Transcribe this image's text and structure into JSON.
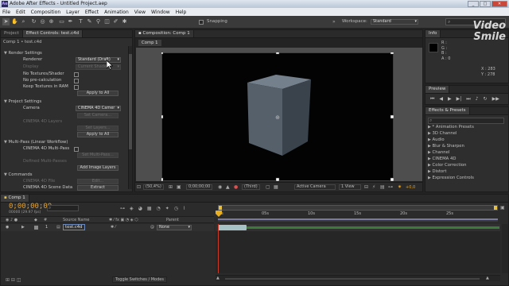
{
  "app": {
    "title": "Adobe After Effects - Untitled Project.aep",
    "logo_text": "Ae",
    "window_controls": [
      "_",
      "□",
      "✕"
    ]
  },
  "menu": [
    "File",
    "Edit",
    "Composition",
    "Layer",
    "Effect",
    "Animation",
    "View",
    "Window",
    "Help"
  ],
  "toolbar": {
    "snapping_label": "Snapping",
    "workspace_label": "Workspace:",
    "workspace_value": "Standard",
    "search_placeholder": "Search Help"
  },
  "left_panel": {
    "tabs": [
      "Project",
      "Effect Controls: test.c4d"
    ],
    "breadcrumb": "Comp 1 • test.c4d",
    "rows": {
      "render_settings": "Render Settings",
      "renderer_label": "Renderer",
      "renderer_value": "Standard (Draft)",
      "display_label": "Display",
      "display_value": "Current Shaded",
      "no_textures": "No Textures/Shader",
      "no_precalc": "No pre-calculation",
      "keep_textures": "Keep Textures in RAM",
      "apply_to_all_1": "Apply to All",
      "project_settings": "Project Settings",
      "camera_label": "Camera",
      "camera_value": "CINEMA 4D Camer",
      "set_camera": "Set Camera...",
      "layers_label": "CINEMA 4D Layers",
      "set_layers": "Set Layers...",
      "apply_to_all_2": "Apply to All",
      "multipass": "Multi-Pass (Linear Workflow)",
      "c4d_multipass": "CINEMA 4D Multi-Pass",
      "set_multipass": "Set Multi-Pass...",
      "defined_multipasses": "Defined Multi-Passes",
      "add_image_layers": "Add Image Layers",
      "commands": "Commands",
      "c4d_file": "CINEMA 4D File",
      "edit_btn": "Edit...",
      "c4d_scene_data": "CINEMA 4D Scene Data",
      "extract_btn": "Extract"
    }
  },
  "composition": {
    "tab": "Composition: Comp 1",
    "sub_tab": "Comp 1",
    "footer": {
      "zoom": "(50,4%)",
      "timecode": "0;00;00;00",
      "resolution": "(Third)",
      "camera": "Active Camera",
      "views": "1 View",
      "offset": "+0,0"
    }
  },
  "right_panels": {
    "info_tab": "Info",
    "info_values": [
      "R :",
      "G :",
      "B :",
      "A : 0",
      "X : 283",
      "Y : 278"
    ],
    "preview_tab": "Preview",
    "effects_tab": "Effects & Presets",
    "effects_search_placeholder": "",
    "effects_items": [
      "* Animation Presets",
      "3D Channel",
      "Audio",
      "Blur & Sharpen",
      "Channel",
      "CINEMA 4D",
      "Color Correction",
      "Distort",
      "Expression Controls"
    ]
  },
  "watermark": {
    "line1": "Video",
    "line2": "Smile"
  },
  "timeline": {
    "tab": "Comp 1",
    "timecode": "0;00;00;00",
    "fps": "00000 (29.97 fps)",
    "search_placeholder": "",
    "headers": {
      "num": "#",
      "source_name": "Source Name",
      "parent": "Parent"
    },
    "layer": {
      "index": "1",
      "name": "test.c4d",
      "parent": "None"
    },
    "ruler": [
      "0s",
      "05s",
      "10s",
      "15s",
      "20s",
      "25s"
    ],
    "toggle_label": "Toggle Switches / Modes"
  }
}
